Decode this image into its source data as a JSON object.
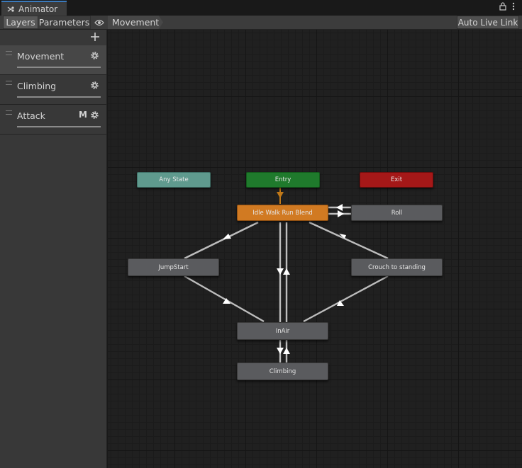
{
  "window": {
    "tab_title": "Animator"
  },
  "toolbar": {
    "layers": "Layers",
    "parameters": "Parameters",
    "breadcrumb": "Movement",
    "auto_live_link": "Auto Live Link"
  },
  "layers": [
    {
      "name": "Movement",
      "selected": true,
      "badge": ""
    },
    {
      "name": "Climbing",
      "selected": false,
      "badge": ""
    },
    {
      "name": "Attack",
      "selected": false,
      "badge": "M"
    }
  ],
  "states": {
    "any_state": "Any State",
    "entry": "Entry",
    "exit": "Exit",
    "idle": "Idle Walk Run Blend",
    "roll": "Roll",
    "jumpstart": "JumpStart",
    "crouch": "Crouch to standing",
    "inair": "InAir",
    "climbing": "Climbing"
  },
  "colors": {
    "any_state": "#5f9a8e",
    "entry": "#1f7a2c",
    "exit": "#a51818",
    "default_state": "#d17a22",
    "state": "#5a5b5e",
    "accent": "#3a79bb"
  }
}
